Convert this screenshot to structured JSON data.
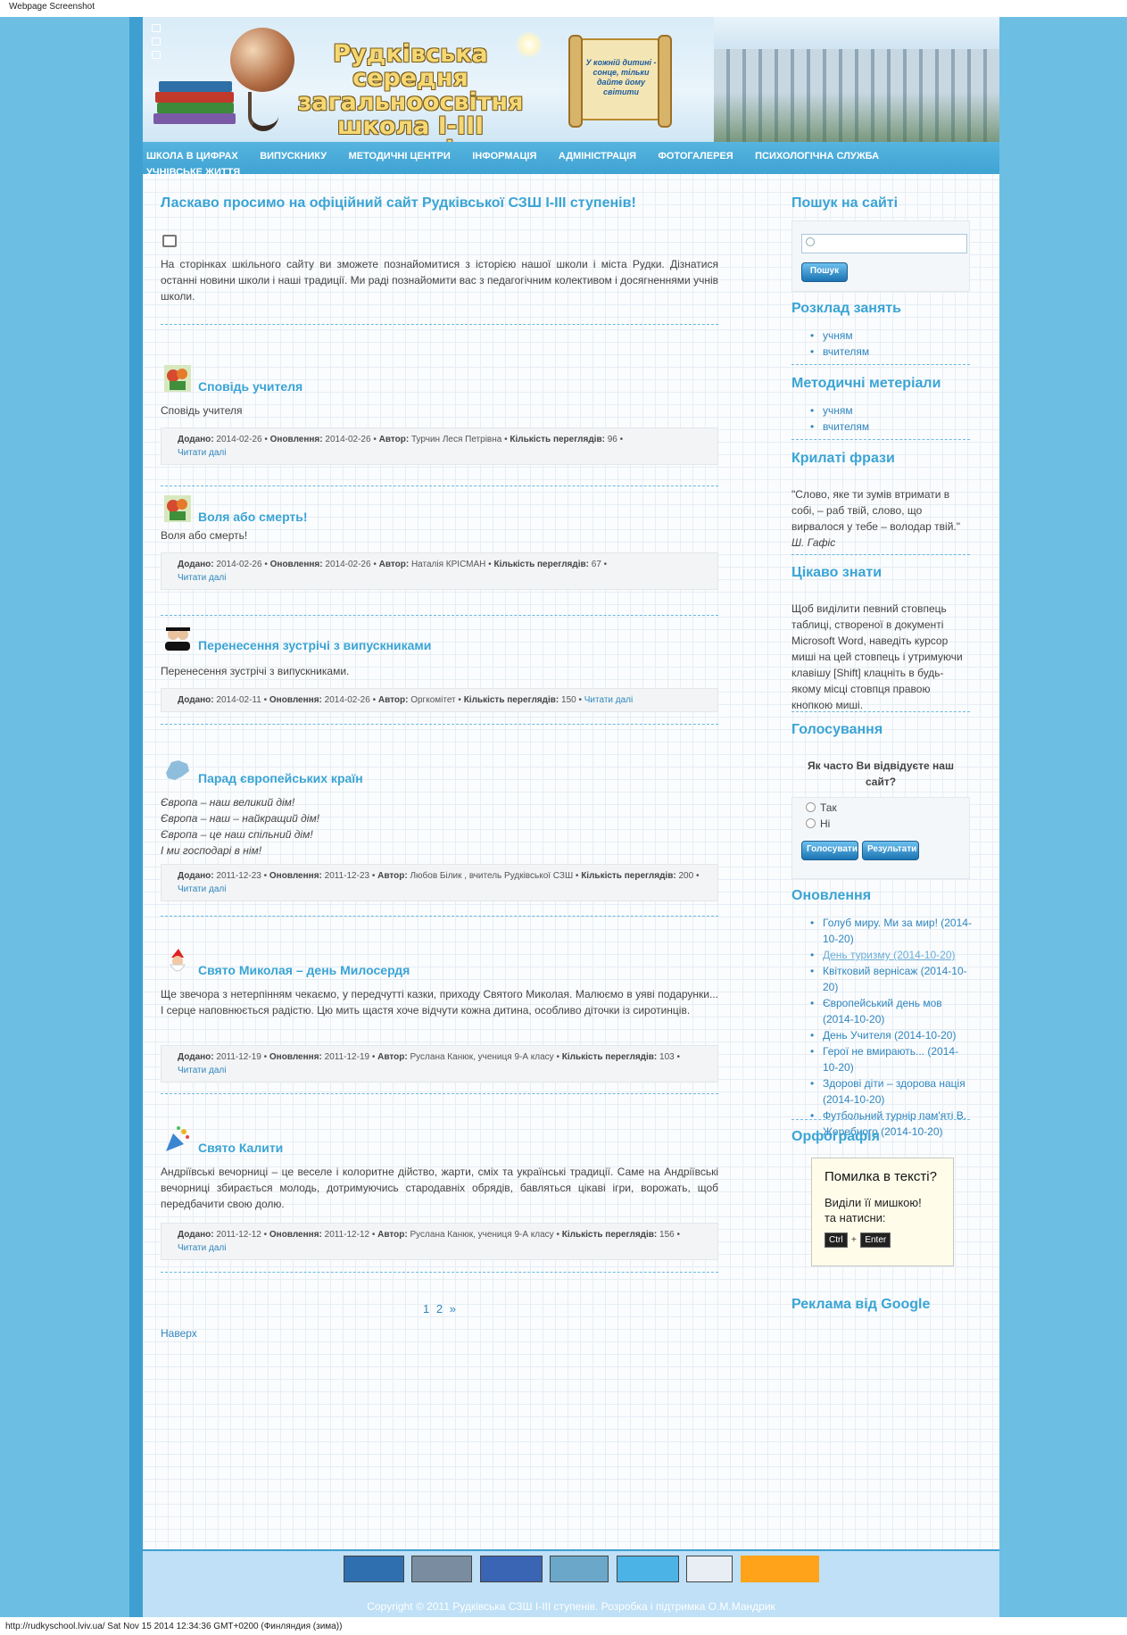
{
  "browser": {
    "caption": "Webpage Screenshot",
    "status_line": "http://rudkyschool.lviv.ua/ Sat Nov 15 2014 12:34:36 GMT+0200 (Финляндия (зима))"
  },
  "header": {
    "school_title": "Рудківська середня загальноосвітня школа І-ІІІ ступенів",
    "scroll_quote": "У кожній дитині - сонце, тільки дайте йому світити"
  },
  "nav": {
    "items": [
      "ШКОЛА В ЦИФРАХ",
      "ВИПУСКНИКУ",
      "МЕТОДИЧНІ ЦЕНТРИ",
      "ІНФОРМАЦІЯ",
      "АДМІНІСТРАЦІЯ",
      "ФОТОГАЛЕРЕЯ",
      "ПСИХОЛОГІЧНА СЛУЖБА",
      "УЧНІВСЬКЕ ЖИТТЯ"
    ]
  },
  "main": {
    "title": "Ласкаво просимо на офіційний сайт Рудківської СЗШ І-ІІІ ступенів!",
    "intro": "На сторінках шкільного сайту ви зможете познайомитися з історією нашої школи і міста Рудки. Дізнатися останні новини школи і наші традиції. Ми раді познайомити вас з педагогічним колективом і досягненнями учнів школи.",
    "meta_labels": {
      "added": "Додано:",
      "updated": "Оновлення:",
      "author": "Автор:",
      "views": "Кількість переглядів:",
      "read_more": "Читати далі"
    },
    "articles": [
      {
        "title": "Сповідь учителя",
        "text": "Сповідь учителя",
        "added": "2014-02-26",
        "updated": "2014-02-26",
        "author": "Турчин Леся Петрівна",
        "views": "96"
      },
      {
        "title": "Воля або смерть!",
        "text": "Воля або смерть!",
        "added": "2014-02-26",
        "updated": "2014-02-26",
        "author": "Наталія КРІСМАН",
        "views": "67"
      },
      {
        "title": "Перенесення зустрічі з випускниками",
        "text": "Перенесення зустрічі з випускниками.",
        "added": "2014-02-11",
        "updated": "2014-02-26",
        "author": "Оргкомітет",
        "views": "150"
      },
      {
        "title": "Парад європейських країн",
        "text_lines": [
          "Європа – наш великий дім!",
          "Європа – наш – найкращий дім!",
          "Європа – це наш спільний дім!",
          "І ми господарі в нім!"
        ],
        "added": "2011-12-23",
        "updated": "2011-12-23",
        "author": "Любов Білик , вчитель Рудківської СЗШ",
        "views": "200"
      },
      {
        "title": "Свято Миколая – день Милосердя",
        "text": "Ще звечора з нетерпінням чекаємо, у передчутті казки, приходу Святого Миколая. Малюємо в уяві подарунки... І серце наповнюється радістю. Цю мить щастя хоче відчути кожна дитина, особливо діточки із сиротинців.",
        "added": "2011-12-19",
        "updated": "2011-12-19",
        "author": "Руслана Канюк, учениця 9-А класу",
        "views": "103"
      },
      {
        "title": "Свято Калити",
        "text": "Андріївські вечорниці – це веселе і колоритне дійство, жарти, сміх та українські традиції. Саме на Андріївські вечорниці збирається молодь, дотримуючись стародавніх обрядів, бавляться цікаві ігри, ворожать, щоб передбачити свою долю.",
        "added": "2011-12-12",
        "updated": "2011-12-12",
        "author": "Руслана Канюк, учениця 9-А класу",
        "views": "156"
      }
    ],
    "pager": {
      "p1": "1",
      "p2": "2",
      "next": "»"
    },
    "top_link": "Наверх"
  },
  "sidebar": {
    "search": {
      "title": "Пошук на сайті",
      "button": "Пошук",
      "value": ""
    },
    "schedule": {
      "title": "Розклад занять",
      "items": [
        "учням",
        "вчителям"
      ]
    },
    "methods": {
      "title": "Методичні метеріали",
      "items": [
        "учням",
        "вчителям"
      ]
    },
    "quotes": {
      "title": "Крилаті фрази",
      "text": "\"Слово, яке ти зумів втримати в собі, – раб твій, слово, що вирвалося у тебе – володар твій.\"",
      "author": "Ш. Гафіс"
    },
    "facts": {
      "title": "Цікаво знати",
      "text": "Щоб виділити певний стовпець таблиці, створеної в документі Microsoft Word, наведіть курсор миші на цей стовпець і утримуючи клавішу [Shift] клацніть в будь-якому місці стовпця правою кнопкою миші."
    },
    "poll": {
      "title": "Голосування",
      "question": "Як часто Ви відвідуєте наш сайт?",
      "options": [
        "Так",
        "Ні"
      ],
      "vote": "Голосувати",
      "results": "Результати"
    },
    "updates": {
      "title": "Оновлення",
      "items": [
        "Голуб миру. Ми за мир! (2014-10-20)",
        "День туризму (2014-10-20)",
        "Квітковий вернісаж (2014-10-20)",
        "Європейський день мов (2014-10-20)",
        "День Учителя (2014-10-20)",
        "Герої не вмирають... (2014-10-20)",
        "Здорові діти – здорова нація (2014-10-20)",
        "Футбольний турнір пам'яті В. Жеребного (2014-10-20)"
      ]
    },
    "ortho": {
      "title": "Орфографія",
      "line1": "Помилка в тексті?",
      "line2": "Виділи її мишкою!",
      "line3": "та натисни:",
      "key1": "Ctrl",
      "plus": "+",
      "key2": "Enter"
    },
    "ads": {
      "title": "Реклама від Google"
    }
  },
  "footer": {
    "copyright": "Copyright © 2011 Рудківська СЗШ І-ІІІ ступенів. Розробка і підтримка О.М.Мандрик",
    "badge_colors": [
      "#2f6fb0",
      "#7a8da0",
      "#3a64b4",
      "#6aa7c9",
      "#4cb3e6",
      "#e9eef4",
      "#ffa31a"
    ]
  },
  "colors": {
    "accent": "#3aa4d5",
    "nav_bg": "#3fa3d3",
    "link": "#2f86bf",
    "page_bg": "#6cbfe2"
  }
}
